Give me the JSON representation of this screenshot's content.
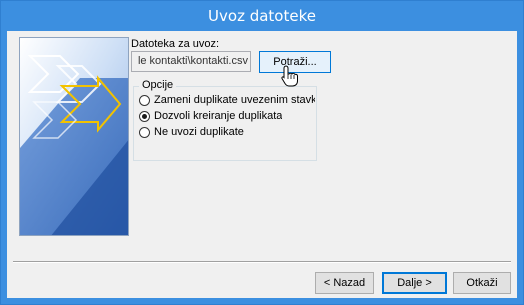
{
  "window": {
    "title": "Uvoz datoteke"
  },
  "file": {
    "label": "Datoteka za uvoz:",
    "path": "le kontakti\\kontakti.csv",
    "browse_label": "Potraži..."
  },
  "options": {
    "legend": "Opcije",
    "items": [
      {
        "label": "Zameni duplikate uvezenim stavkama",
        "selected": false
      },
      {
        "label": "Dozvoli kreiranje duplikata",
        "selected": true
      },
      {
        "label": "Ne uvozi duplikate",
        "selected": false
      }
    ]
  },
  "buttons": {
    "back": "< Nazad",
    "next": "Dalje >",
    "cancel": "Otkaži"
  },
  "icons": {
    "wizard_art": "import-wizard-arrows-art",
    "cursor": "hand-pointer-icon"
  },
  "colors": {
    "titlebar": "#3c8fe0",
    "client_bg": "#f0f0f0",
    "default_button_border": "#0078d7"
  }
}
